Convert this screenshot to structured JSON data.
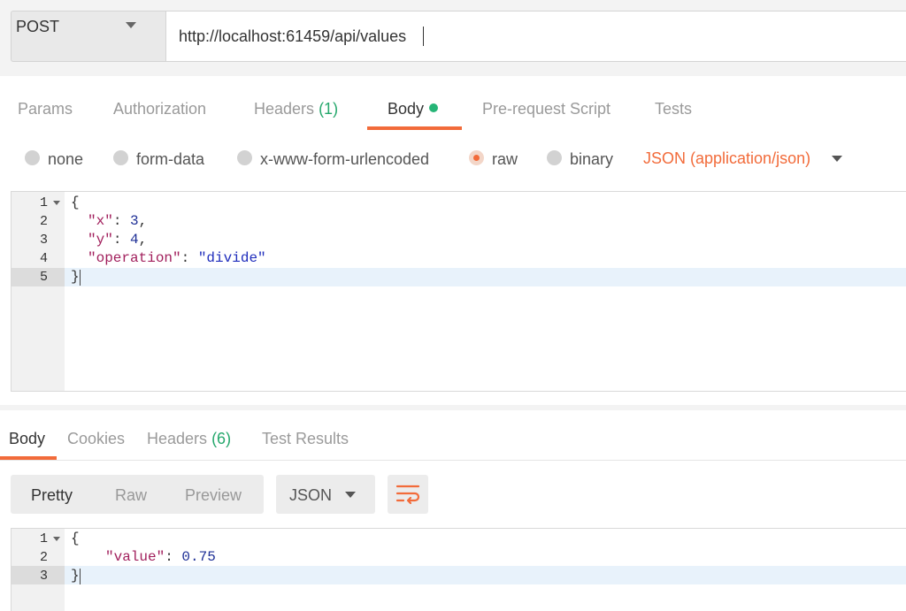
{
  "request": {
    "method": "POST",
    "url": "http://localhost:61459/api/values"
  },
  "request_tabs": [
    {
      "label": "Params"
    },
    {
      "label": "Authorization"
    },
    {
      "label": "Headers",
      "count": "(1)"
    },
    {
      "label": "Body"
    },
    {
      "label": "Pre-request Script"
    },
    {
      "label": "Tests"
    }
  ],
  "body_types": {
    "none": "none",
    "form_data": "form-data",
    "urlencoded": "x-www-form-urlencoded",
    "raw": "raw",
    "binary": "binary",
    "content_type": "JSON (application/json)"
  },
  "request_body": {
    "line_numbers": [
      "1",
      "2",
      "3",
      "4",
      "5"
    ],
    "brace_open": "{",
    "brace_close": "}",
    "x_key": "\"x\"",
    "x_val": "3",
    "y_key": "\"y\"",
    "y_val": "4",
    "op_key": "\"operation\"",
    "op_val": "\"divide\"",
    "colon": ": ",
    "comma": ","
  },
  "response_tabs": [
    {
      "label": "Body"
    },
    {
      "label": "Cookies"
    },
    {
      "label": "Headers",
      "count": "(6)"
    },
    {
      "label": "Test Results"
    }
  ],
  "response_view": {
    "modes": [
      "Pretty",
      "Raw",
      "Preview"
    ],
    "format": "JSON"
  },
  "response_body": {
    "line_numbers": [
      "1",
      "2",
      "3"
    ],
    "brace_open": "{",
    "brace_close": "}",
    "value_key": "\"value\"",
    "value_val": "0.75",
    "colon": ": "
  },
  "colors": {
    "accent": "#f26b3a",
    "count_green": "#26a86d",
    "json_key": "#a11f5c",
    "json_number": "#1e2f96",
    "json_string": "#1f2dbc"
  },
  "icons": {
    "method_dropdown": "chevron-down-icon",
    "body_dot": "status-dot-icon",
    "content_type_dropdown": "chevron-down-icon",
    "format_dropdown": "chevron-down-icon",
    "wrap": "word-wrap-icon",
    "fold": "fold-arrow-icon"
  }
}
